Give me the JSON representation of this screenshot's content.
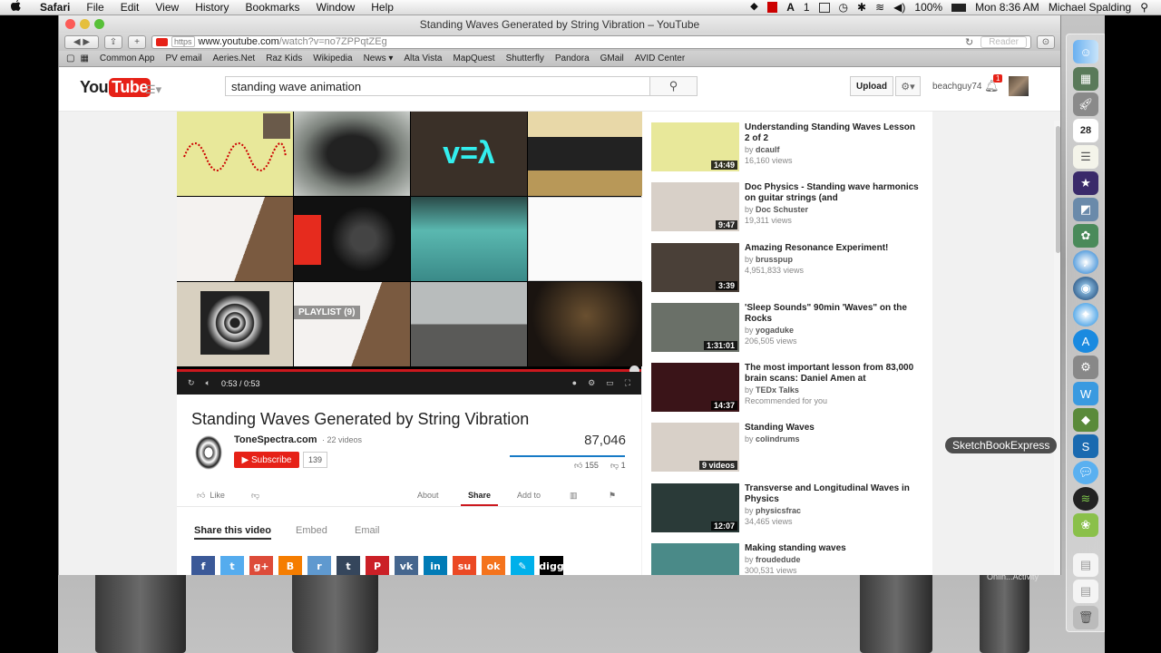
{
  "menubar": {
    "apple": "",
    "app": "Safari",
    "items": [
      "File",
      "Edit",
      "View",
      "History",
      "Bookmarks",
      "Window",
      "Help"
    ],
    "adobe": "1",
    "battery": "100%",
    "clock": "Mon 8:36 AM",
    "user": "Michael Spalding"
  },
  "browser": {
    "window_title": "Standing Waves Generated by String Vibration – YouTube",
    "https": "https",
    "url_domain": "www.youtube.com",
    "url_path": "/watch?v=no7ZPPqtZEg",
    "reader": "Reader",
    "bookmarks": [
      "Common App",
      "PV email",
      "Aeries.Net",
      "Raz Kids",
      "Wikipedia",
      "News ▾",
      "Alta Vista",
      "MapQuest",
      "Shutterfly",
      "Pandora",
      "GMail",
      "AVID Center"
    ]
  },
  "youtube": {
    "logo_you": "You",
    "logo_tube": "Tube",
    "search_value": "standing wave animation",
    "upload": "Upload",
    "username": "beachguy74",
    "notif_count": "1",
    "player": {
      "playlist": "PLAYLIST (9)",
      "time": "0:53 / 0:53"
    },
    "video": {
      "title": "Standing Waves Generated by String Vibration",
      "channel": "ToneSpectra.com",
      "videos": "· 22 videos",
      "subscribe": "Subscribe",
      "sub_count": "139",
      "views": "87,046",
      "likes": "155",
      "dislikes": "1",
      "like_label": "Like",
      "like_ratio": 0.99
    },
    "actions": {
      "about": "About",
      "share": "Share",
      "add_to": "Add to"
    },
    "share": {
      "tabs": [
        "Share this video",
        "Embed",
        "Email"
      ],
      "socials": [
        {
          "name": "facebook",
          "glyph": "f",
          "color": "#3b5998"
        },
        {
          "name": "twitter",
          "glyph": "t",
          "color": "#55acee"
        },
        {
          "name": "googleplus",
          "glyph": "g+",
          "color": "#dd4b39"
        },
        {
          "name": "blogger",
          "glyph": "B",
          "color": "#f57d00"
        },
        {
          "name": "reddit",
          "glyph": "r",
          "color": "#5f99cf"
        },
        {
          "name": "tumblr",
          "glyph": "t",
          "color": "#35465c"
        },
        {
          "name": "pinterest",
          "glyph": "P",
          "color": "#cb2027"
        },
        {
          "name": "vk",
          "glyph": "vk",
          "color": "#45668e"
        },
        {
          "name": "linkedin",
          "glyph": "in",
          "color": "#007bb6"
        },
        {
          "name": "stumbleupon",
          "glyph": "su",
          "color": "#eb4924"
        },
        {
          "name": "odnoklassniki",
          "glyph": "ok",
          "color": "#f4731c"
        },
        {
          "name": "livejournal",
          "glyph": "✎",
          "color": "#00b0ea"
        },
        {
          "name": "digg",
          "glyph": "digg",
          "color": "#000000"
        }
      ]
    },
    "related": [
      {
        "title": "Understanding Standing Waves Lesson 2 of 2",
        "by": "by",
        "channel": "dcaulf",
        "views": "16,160 views",
        "duration": "14:49",
        "thumb": "#e8e89a"
      },
      {
        "title": "Doc Physics - Standing wave harmonics on guitar strings (and",
        "by": "by",
        "channel": "Doc Schuster",
        "views": "19,311 views",
        "duration": "9:47",
        "thumb": "#d8d0c8"
      },
      {
        "title": "Amazing Resonance Experiment!",
        "by": "by",
        "channel": "brusspup",
        "views": "4,951,833 views",
        "duration": "3:39",
        "thumb": "#4a4038"
      },
      {
        "title": "'Sleep Sounds\" 90min 'Waves\" on the Rocks",
        "by": "by",
        "channel": "yogaduke",
        "views": "206,505 views",
        "duration": "1:31:01",
        "thumb": "#6a7068"
      },
      {
        "title": "The most important lesson from 83,000 brain scans: Daniel Amen at",
        "by": "by",
        "channel": "TEDx Talks",
        "views": "Recommended for you",
        "duration": "14:37",
        "thumb": "#3a1418"
      },
      {
        "title": "Standing Waves",
        "by": "by",
        "channel": "colindrums",
        "views": "",
        "duration": "9 videos",
        "thumb": "#d8d0c8"
      },
      {
        "title": "Transverse and Longitudinal Waves in Physics",
        "by": "by",
        "channel": "physicsfrac",
        "views": "34,465 views",
        "duration": "12:07",
        "thumb": "#2a3a38"
      },
      {
        "title": "Making standing waves",
        "by": "by",
        "channel": "froudedude",
        "views": "300,531 views",
        "duration": "",
        "thumb": "#4a8a88"
      }
    ]
  },
  "dock": {
    "tooltip": "SketchBookExpress"
  },
  "desktop": {
    "bg_text": "Onlin...Activity"
  }
}
